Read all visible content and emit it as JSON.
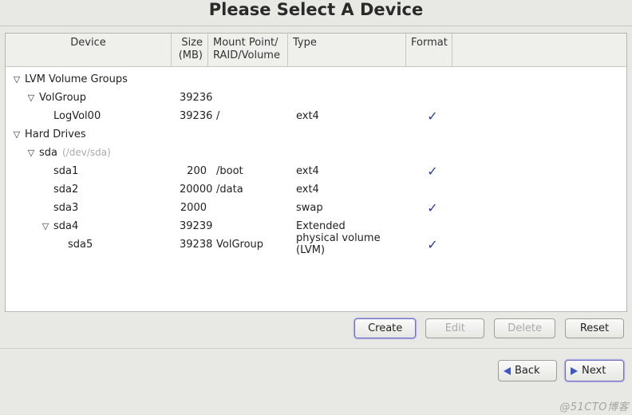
{
  "title": "Please Select A Device",
  "columns": {
    "device": "Device",
    "size": "Size\n(MB)",
    "mount": "Mount Point/\nRAID/Volume",
    "type": "Type",
    "format": "Format"
  },
  "rows": [
    {
      "indent": 0,
      "expander": true,
      "label": "LVM Volume Groups",
      "size": "",
      "mount": "",
      "type": "",
      "format": false
    },
    {
      "indent": 1,
      "expander": true,
      "label": "VolGroup",
      "size": "39236",
      "mount": "",
      "type": "",
      "format": false
    },
    {
      "indent": 2,
      "expander": false,
      "label": "LogVol00",
      "size": "39236",
      "mount": "/",
      "type": "ext4",
      "format": true
    },
    {
      "indent": 0,
      "expander": true,
      "label": "Hard Drives",
      "size": "",
      "mount": "",
      "type": "",
      "format": false
    },
    {
      "indent": 1,
      "expander": true,
      "label": "sda",
      "devpath": "(/dev/sda)",
      "size": "",
      "mount": "",
      "type": "",
      "format": false
    },
    {
      "indent": 2,
      "expander": false,
      "label": "sda1",
      "size": "200",
      "mount": "/boot",
      "type": "ext4",
      "format": true
    },
    {
      "indent": 2,
      "expander": false,
      "label": "sda2",
      "size": "20000",
      "mount": "/data",
      "type": "ext4",
      "format": false
    },
    {
      "indent": 2,
      "expander": false,
      "label": "sda3",
      "size": "2000",
      "mount": "",
      "type": "swap",
      "format": true
    },
    {
      "indent": 2,
      "expander": true,
      "label": "sda4",
      "size": "39239",
      "mount": "",
      "type": "Extended",
      "format": false
    },
    {
      "indent": 3,
      "expander": false,
      "label": "sda5",
      "size": "39238",
      "mount": "VolGroup",
      "type": "physical volume (LVM)",
      "format": true
    }
  ],
  "buttons": {
    "create": "Create",
    "edit": "Edit",
    "delete": "Delete",
    "reset": "Reset",
    "back": "Back",
    "next": "Next"
  },
  "watermark": "@51CTO博客"
}
